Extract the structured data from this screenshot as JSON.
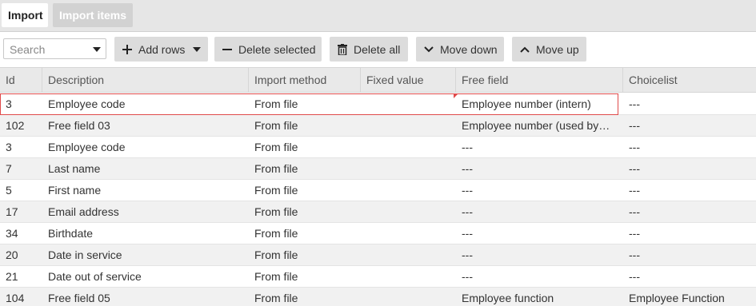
{
  "tabs": [
    {
      "label": "Import",
      "active": true
    },
    {
      "label": "Import items",
      "active": false
    }
  ],
  "toolbar": {
    "search_placeholder": "Search",
    "add_rows": "Add rows",
    "delete_selected": "Delete selected",
    "delete_all": "Delete all",
    "move_down": "Move down",
    "move_up": "Move up"
  },
  "colors": {
    "selection_border": "#e04a4a",
    "tab_bar": "#e6e6e6"
  },
  "grid": {
    "columns": [
      "Id",
      "Description",
      "Import method",
      "Fixed value",
      "Free field",
      "Choicelist"
    ],
    "rows": [
      {
        "id": "3",
        "description": "Employee code",
        "import_method": "From file",
        "fixed_value": "",
        "free_field": "Employee number (intern)",
        "choicelist": "---",
        "selected": true
      },
      {
        "id": "102",
        "description": "Free field 03",
        "import_method": "From file",
        "fixed_value": "",
        "free_field": "Employee number (used by…",
        "choicelist": "---"
      },
      {
        "id": "3",
        "description": "Employee code",
        "import_method": "From file",
        "fixed_value": "",
        "free_field": "---",
        "choicelist": "---"
      },
      {
        "id": "7",
        "description": "Last name",
        "import_method": "From file",
        "fixed_value": "",
        "free_field": "---",
        "choicelist": "---"
      },
      {
        "id": "5",
        "description": "First name",
        "import_method": "From file",
        "fixed_value": "",
        "free_field": "---",
        "choicelist": "---"
      },
      {
        "id": "17",
        "description": "Email address",
        "import_method": "From file",
        "fixed_value": "",
        "free_field": "---",
        "choicelist": "---"
      },
      {
        "id": "34",
        "description": "Birthdate",
        "import_method": "From file",
        "fixed_value": "",
        "free_field": "---",
        "choicelist": "---"
      },
      {
        "id": "20",
        "description": "Date in service",
        "import_method": "From file",
        "fixed_value": "",
        "free_field": "---",
        "choicelist": "---"
      },
      {
        "id": "21",
        "description": "Date out of service",
        "import_method": "From file",
        "fixed_value": "",
        "free_field": "---",
        "choicelist": "---"
      },
      {
        "id": "104",
        "description": "Free field 05",
        "import_method": "From file",
        "fixed_value": "",
        "free_field": "Employee function",
        "choicelist": "Employee Function"
      }
    ]
  }
}
